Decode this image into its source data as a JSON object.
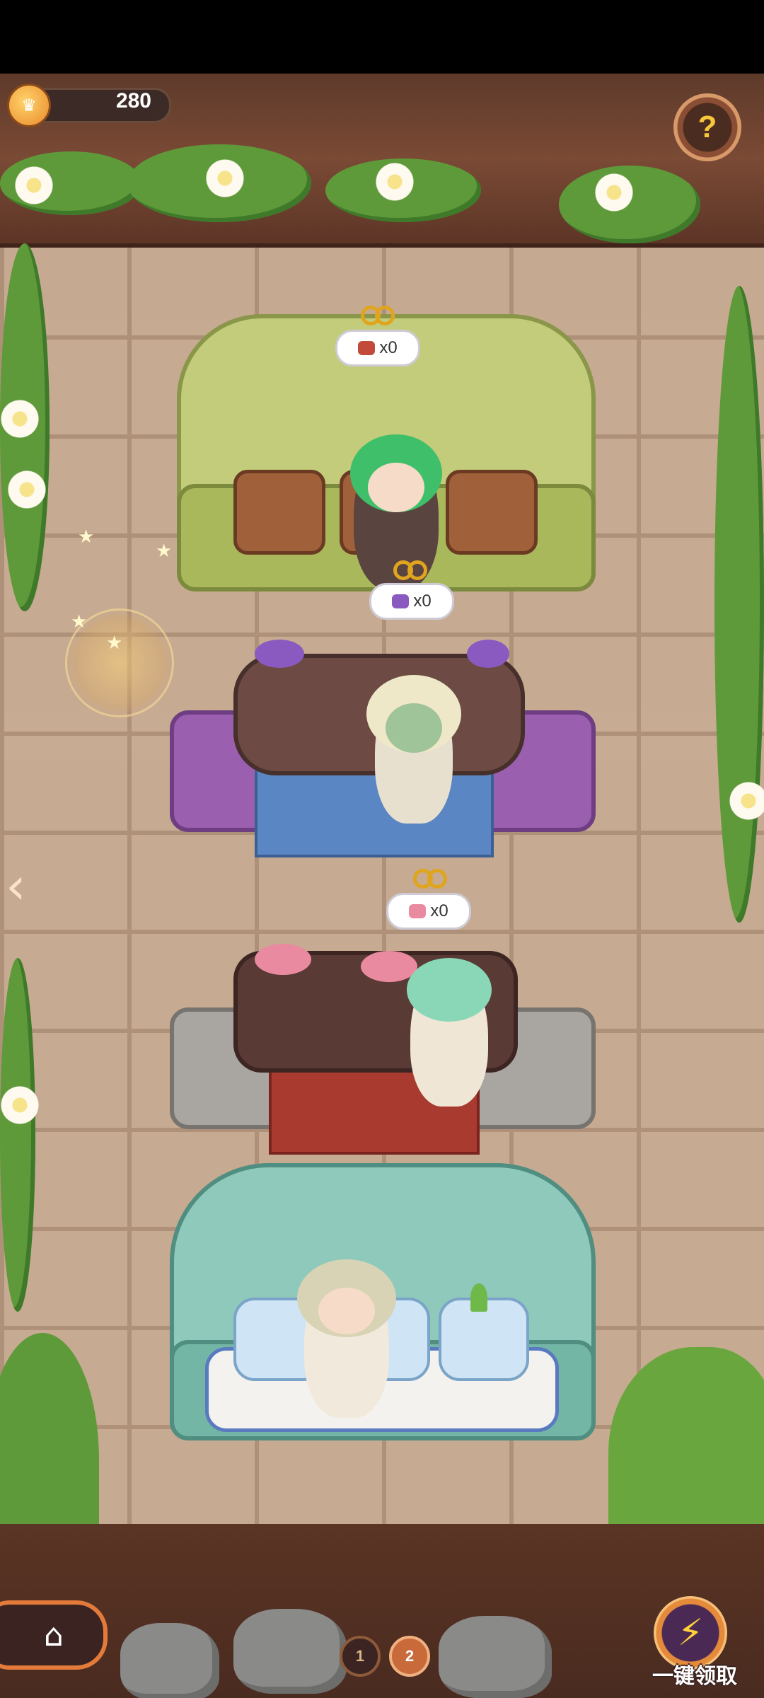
{
  "status_bar": {},
  "currency": {
    "icon": "crown-coin-icon",
    "value": "280"
  },
  "help_button": {
    "icon": "help-sprout-icon",
    "label": "?"
  },
  "stations": [
    {
      "name": "forge",
      "key_icon": "golden-key-icon",
      "item_icon": "red-ore-icon",
      "count": "x0",
      "bench_color": "#b7c46a"
    },
    {
      "name": "mushroom-log",
      "key_icon": "golden-key-icon",
      "item_icon": "purple-mushroom-icon",
      "count": "x0",
      "bench_color": "#9b5fb0"
    },
    {
      "name": "fungus-log",
      "key_icon": "golden-key-icon",
      "item_icon": "pink-fungus-icon",
      "count": "x0",
      "bench_color": "#a19d99"
    },
    {
      "name": "sprout-pots",
      "key_icon": "golden-key-icon",
      "item_icon": "sprout-icon",
      "count": "",
      "bench_color": "#74b6a6"
    }
  ],
  "navigation": {
    "left_arrow": "‹",
    "home_icon": "⌂"
  },
  "pages": [
    "1",
    "2"
  ],
  "collect_all": {
    "icon": "lightning-icon",
    "glyph": "⚡",
    "label": "一键领取"
  }
}
